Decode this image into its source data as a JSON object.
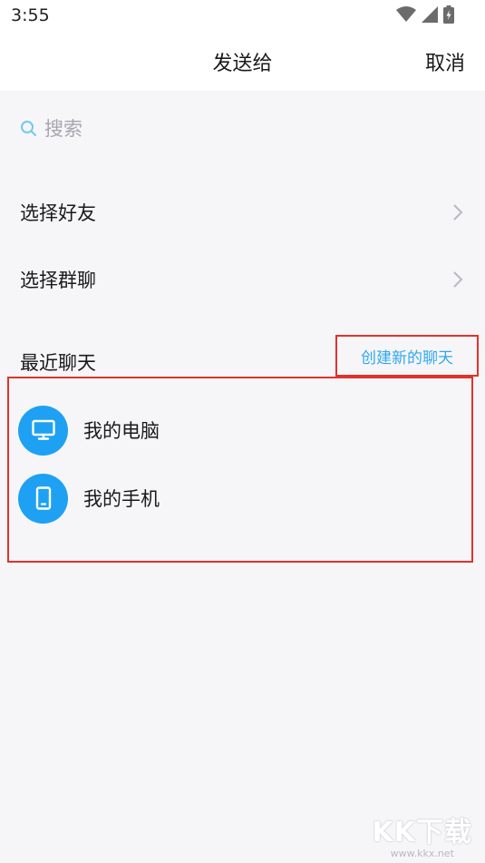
{
  "status_bar": {
    "time": "3:55"
  },
  "header": {
    "title": "发送给",
    "cancel_label": "取消"
  },
  "search": {
    "placeholder": "搜索"
  },
  "menu": {
    "select_friends": "选择好友",
    "select_groups": "选择群聊"
  },
  "recent": {
    "section_title": "最近聊天",
    "create_chat_label": "创建新的聊天",
    "contacts": [
      {
        "name": "我的电脑",
        "icon": "monitor-icon"
      },
      {
        "name": "我的手机",
        "icon": "phone-icon"
      }
    ]
  },
  "watermark": {
    "logo": "KK下载",
    "url": "www.kkx.net"
  },
  "colors": {
    "accent": "#1ea1f2",
    "link": "#2fa8ee",
    "highlight_border": "#e3312b",
    "background": "#f6f6f9"
  }
}
